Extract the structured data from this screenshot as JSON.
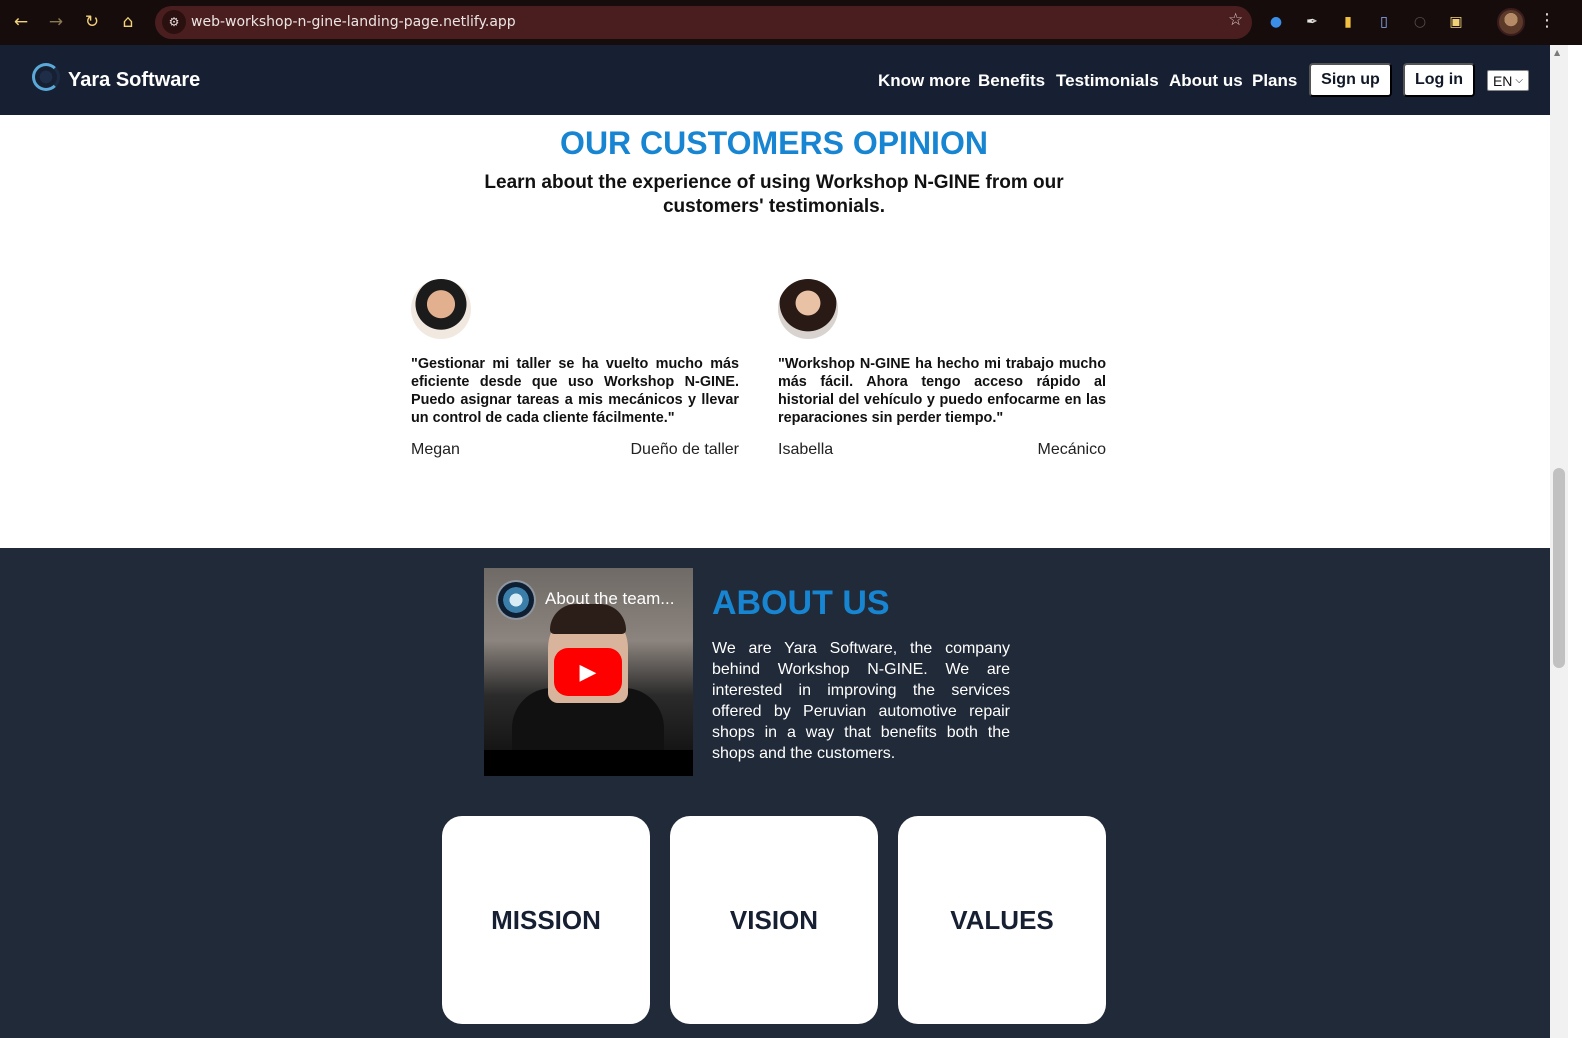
{
  "browser": {
    "url": "web-workshop-n-gine-landing-page.netlify.app"
  },
  "header": {
    "brand": "Yara Software",
    "nav": [
      "Know more",
      "Benefits",
      "Testimonials",
      "About us",
      "Plans"
    ],
    "signup": "Sign up",
    "login": "Log in",
    "language": "EN"
  },
  "testimonials": {
    "title": "OUR CUSTOMERS OPINION",
    "subtitle": "Learn about the experience of using Workshop N-GINE from our customers' testimonials.",
    "items": [
      {
        "quote": "\"Gestionar mi taller se ha vuelto mucho más eficiente desde que uso Workshop N-GINE. Puedo asignar tareas a mis mecánicos y llevar un control de cada cliente fácilmente.\"",
        "name": "Megan",
        "role": "Dueño de taller"
      },
      {
        "quote": "\"Workshop N-GINE ha hecho mi trabajo mucho más fácil. Ahora tengo acceso rápido al historial del vehículo y puedo enfocarme en las reparaciones sin perder tiempo.\"",
        "name": "Isabella",
        "role": "Mecánico"
      }
    ]
  },
  "about": {
    "video_title": "About the team...",
    "title": "ABOUT US",
    "text": "We are Yara Software, the company behind Workshop N-GINE. We are interested in improving the services offered by Peruvian automotive repair shops in a way that benefits both the shops and the customers.",
    "cards": [
      "MISSION",
      "VISION",
      "VALUES"
    ]
  }
}
